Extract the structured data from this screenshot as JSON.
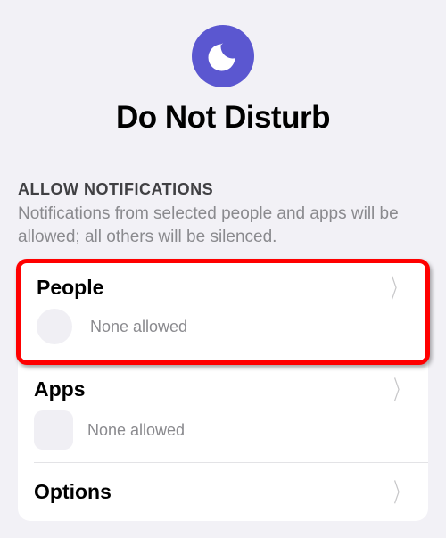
{
  "header": {
    "title": "Do Not Disturb",
    "icon_name": "moon-icon"
  },
  "section": {
    "title": "Allow Notifications",
    "description": "Notifications from selected people and apps will be allowed; all others will be silenced."
  },
  "rows": {
    "people": {
      "label": "People",
      "subtext": "None allowed"
    },
    "apps": {
      "label": "Apps",
      "subtext": "None allowed"
    },
    "options": {
      "label": "Options"
    }
  }
}
